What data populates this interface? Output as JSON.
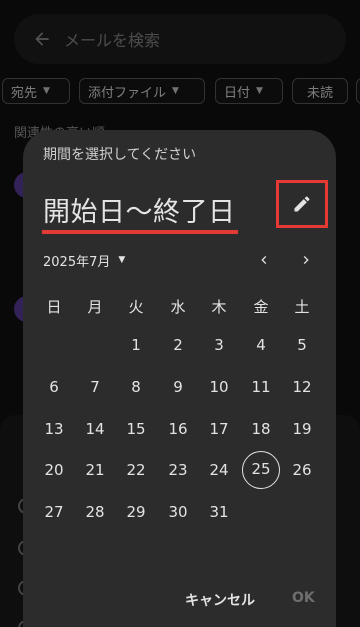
{
  "search": {
    "placeholder": "メールを検索"
  },
  "filters": [
    "宛先",
    "添付ファイル",
    "日付",
    "未読"
  ],
  "background": {
    "section_label": "関連性の高い順"
  },
  "dialog": {
    "title": "期間を選択してください",
    "range_text": "開始日〜終了日",
    "month_label": "2025年7月",
    "weekdays": [
      "日",
      "月",
      "火",
      "水",
      "木",
      "金",
      "土"
    ],
    "calendar": {
      "first_weekday_index": 2,
      "days_in_month": 31,
      "today": 25
    },
    "actions": {
      "cancel": "キャンセル",
      "ok": "OK"
    }
  },
  "colors": {
    "highlight": "#e53935",
    "dialog_bg": "#2c2c2c"
  }
}
